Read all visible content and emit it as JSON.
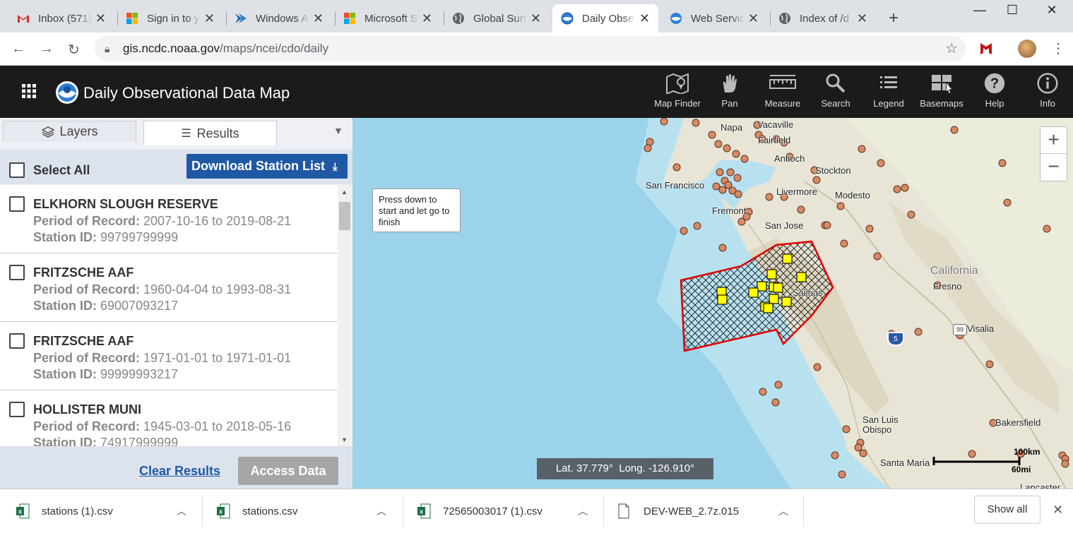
{
  "browser": {
    "tabs": [
      {
        "title": "Inbox (571)",
        "icon": "gmail-icon"
      },
      {
        "title": "Sign in to y",
        "icon": "microsoft-icon"
      },
      {
        "title": "Windows A",
        "icon": "azure-icon"
      },
      {
        "title": "Microsoft S",
        "icon": "microsoft-icon"
      },
      {
        "title": "Global Surf",
        "icon": "globe-icon"
      },
      {
        "title": "Daily Obse",
        "icon": "noaa-icon"
      },
      {
        "title": "Web Servic",
        "icon": "noaa-icon"
      },
      {
        "title": "Index of /d",
        "icon": "globe-icon"
      }
    ],
    "active_tab": 5,
    "url_host": "gis.ncdc.noaa.gov",
    "url_path": "/maps/ncei/cdo/daily"
  },
  "app": {
    "title": "Daily Observational Data Map",
    "tools": [
      {
        "label": "Map Finder",
        "icon": "map-finder-icon"
      },
      {
        "label": "Pan",
        "icon": "hand-icon"
      },
      {
        "label": "Measure",
        "icon": "ruler-icon"
      },
      {
        "label": "Search",
        "icon": "search-icon"
      },
      {
        "label": "Legend",
        "icon": "list-icon"
      },
      {
        "label": "Basemaps",
        "icon": "basemaps-icon"
      },
      {
        "label": "Help",
        "icon": "help-icon"
      },
      {
        "label": "Info",
        "icon": "info-icon"
      }
    ]
  },
  "panel": {
    "tab_layers": "Layers",
    "tab_results": "Results",
    "select_all": "Select All",
    "download_list": "Download Station List",
    "period_label": "Period of Record:",
    "station_label": "Station ID:",
    "stations": [
      {
        "name": "ELKHORN SLOUGH RESERVE",
        "period": "2007-10-16 to 2019-08-21",
        "id": "99799799999"
      },
      {
        "name": "FRITZSCHE AAF",
        "period": "1960-04-04 to 1993-08-31",
        "id": "69007093217"
      },
      {
        "name": "FRITZSCHE AAF",
        "period": "1971-01-01 to 1971-01-01",
        "id": "99999993217"
      },
      {
        "name": "HOLLISTER MUNI",
        "period": "1945-03-01 to 2018-05-16",
        "id": "74917999999"
      }
    ],
    "clear_results": "Clear Results",
    "access_data": "Access Data"
  },
  "map": {
    "tooltip": "Press down to start and let go to finish",
    "zoom_in": "+",
    "zoom_out": "−",
    "coords": "Lat. 37.779°  Long. -126.910°",
    "scale_km": "100km",
    "scale_mi": "60mi",
    "interstate": "5",
    "highway": "99",
    "places": [
      "Napa",
      "Vacaville",
      "Fairfield",
      "Antioch",
      "Stockton",
      "San Francisco",
      "Livermore",
      "Modesto",
      "Fremont",
      "San Jose",
      "California",
      "Fresno",
      "Salinas",
      "Visalia",
      "San Luis Obispo",
      "Bakersfield",
      "Santa Maria",
      "Lancaster"
    ]
  },
  "downloads": {
    "files": [
      {
        "name": "stations (1).csv",
        "icon": "excel-file-icon"
      },
      {
        "name": "stations.csv",
        "icon": "excel-file-icon"
      },
      {
        "name": "72565003017 (1).csv",
        "icon": "excel-file-icon"
      },
      {
        "name": "DEV-WEB_2.7z.015",
        "icon": "file-icon"
      }
    ],
    "show_all": "Show all"
  }
}
